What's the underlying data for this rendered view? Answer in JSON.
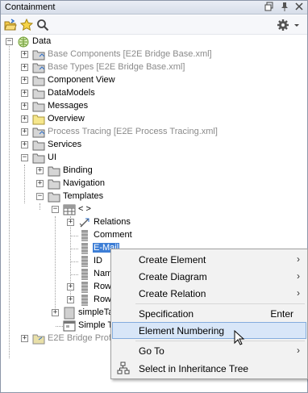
{
  "panel": {
    "title": "Containment"
  },
  "tree": {
    "nodes": [
      {
        "label": "Data"
      },
      {
        "label": "Base Components [E2E Bridge Base.xml]"
      },
      {
        "label": "Base Types [E2E Bridge Base.xml]"
      },
      {
        "label": "Component View"
      },
      {
        "label": "DataModels"
      },
      {
        "label": "Messages"
      },
      {
        "label": "Overview"
      },
      {
        "label": "Process Tracing [E2E Process Tracing.xml]"
      },
      {
        "label": "Services"
      },
      {
        "label": "UI"
      },
      {
        "label": "Binding"
      },
      {
        "label": "Navigation"
      },
      {
        "label": "Templates"
      },
      {
        "label": "< >"
      },
      {
        "label": "Relations"
      },
      {
        "label": "Comment"
      },
      {
        "label": "E-Mail"
      },
      {
        "label": "ID"
      },
      {
        "label": "Nam"
      },
      {
        "label": "Row"
      },
      {
        "label": "Row"
      },
      {
        "label": "simpleTa"
      },
      {
        "label": "Simple Ta"
      },
      {
        "label": "E2E Bridge Profil"
      }
    ]
  },
  "context_menu": {
    "items": [
      {
        "label": "Create Element",
        "submenu": true
      },
      {
        "label": "Create Diagram",
        "submenu": true
      },
      {
        "label": "Create Relation",
        "submenu": true
      },
      {
        "label": "Specification",
        "shortcut": "Enter"
      },
      {
        "label": "Element Numbering"
      },
      {
        "label": "Go To",
        "submenu": true
      },
      {
        "label": "Select in Inheritance Tree"
      }
    ]
  }
}
